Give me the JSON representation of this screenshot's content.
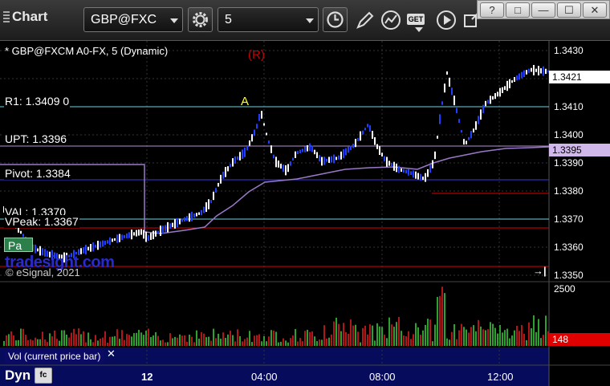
{
  "window": {
    "title": "Chart",
    "symbol_value": "GBP@FXC",
    "interval_value": "5",
    "get_badge": "GET",
    "controls": [
      "?",
      "□",
      "—",
      "☐",
      "✕"
    ]
  },
  "chart": {
    "symbol_label": "* GBP@FXCM A0-FX, 5 (Dynamic)",
    "r_marker": "(R)",
    "a_marker": "A",
    "levels": {
      "r1": "R1: 1.3409",
      "r1_suffix": "0",
      "upt": "UPT: 1.3396",
      "pivot": "Pivot: 1.3384",
      "val": "VAL: 1.3370",
      "peak": "VPeak: 1.3367",
      "pill": "Pa"
    },
    "price_axis": [
      "1.3430",
      "1.3410",
      "1.3400",
      "1.3390",
      "1.3380",
      "1.3370",
      "1.3360",
      "1.3350"
    ],
    "current_price": "1.3421",
    "vpoc_price": "1.3395",
    "watermark": "tradesight.com",
    "copyright": "© eSignal, 2021",
    "volume_axis": "2500",
    "volume_current": "148",
    "volume_pane_label": "Vol (current price bar)",
    "volume_pane_close": "✕",
    "pane_arrow": "→|",
    "bottom_left": "Dyn",
    "fc_button": "fc",
    "time_labels": [
      {
        "label": "12",
        "bold": true
      },
      {
        "label": "04:00",
        "bold": false
      },
      {
        "label": "08:00",
        "bold": false
      },
      {
        "label": "12:00",
        "bold": false
      }
    ]
  },
  "colors": {
    "up_bar": "#ffffff",
    "down_bar": "#2040ff",
    "r1_line": "#6fd0e0",
    "upt_line": "#b68fd8",
    "pivot_line": "#3a3ad8",
    "val_line": "#6fd0e0",
    "red_line": "#e00000",
    "vpoc_curve": "#9a78c8",
    "volume_up": "#2ea02e",
    "volume_down": "#b01818",
    "volume_pane_bg": "#060b5c"
  }
}
